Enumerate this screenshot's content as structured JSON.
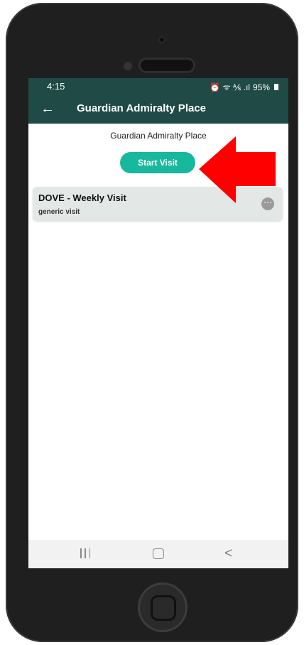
{
  "status_bar": {
    "time": "4:15",
    "icons_text": "⏰ ᯤ ⅍ .ıl",
    "battery": "95%"
  },
  "app_bar": {
    "title": "Guardian Admiralty Place"
  },
  "page": {
    "heading": "Guardian Admiralty Place",
    "start_button_label": "Start Visit"
  },
  "visit_card": {
    "title": "DOVE - Weekly Visit",
    "subtitle": "generic visit",
    "more_icon": "⋯"
  },
  "nav_bar": {
    "back_glyph": "<"
  },
  "colors": {
    "app_bar": "#1f4a45",
    "accent": "#17b89d",
    "arrow": "#ff0000"
  }
}
